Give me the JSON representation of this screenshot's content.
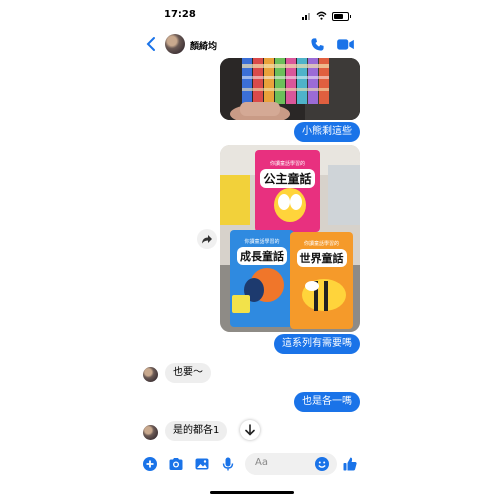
{
  "status_bar": {
    "time": "17:28"
  },
  "header": {
    "contact_name": "顏綺均"
  },
  "messages": [
    {
      "kind": "image_out",
      "caption": ""
    },
    {
      "kind": "text_out",
      "text": "小熊剩這些"
    },
    {
      "kind": "image_out_books",
      "books": [
        {
          "subtitle": "你讀童話學習的",
          "title": "公主童話"
        },
        {
          "subtitle": "你讀童話學習的",
          "title": "成長童話"
        },
        {
          "subtitle": "你讀童話學習的",
          "title": "世界童話"
        }
      ]
    },
    {
      "kind": "text_out",
      "text": "這系列有需要嗎"
    },
    {
      "kind": "text_in",
      "text": "也要～"
    },
    {
      "kind": "text_out",
      "text": "也是各一嗎"
    },
    {
      "kind": "text_in",
      "text": "是的都各1"
    }
  ],
  "composer": {
    "placeholder": "Aa"
  },
  "colors": {
    "accent": "#1a73e8",
    "bubble_in": "#eeeeee"
  },
  "icons": [
    "back-icon",
    "phone-icon",
    "video-icon",
    "share-icon",
    "scroll-down-icon",
    "plus-icon",
    "camera-icon",
    "gallery-icon",
    "mic-icon",
    "emoji-icon",
    "like-icon"
  ]
}
